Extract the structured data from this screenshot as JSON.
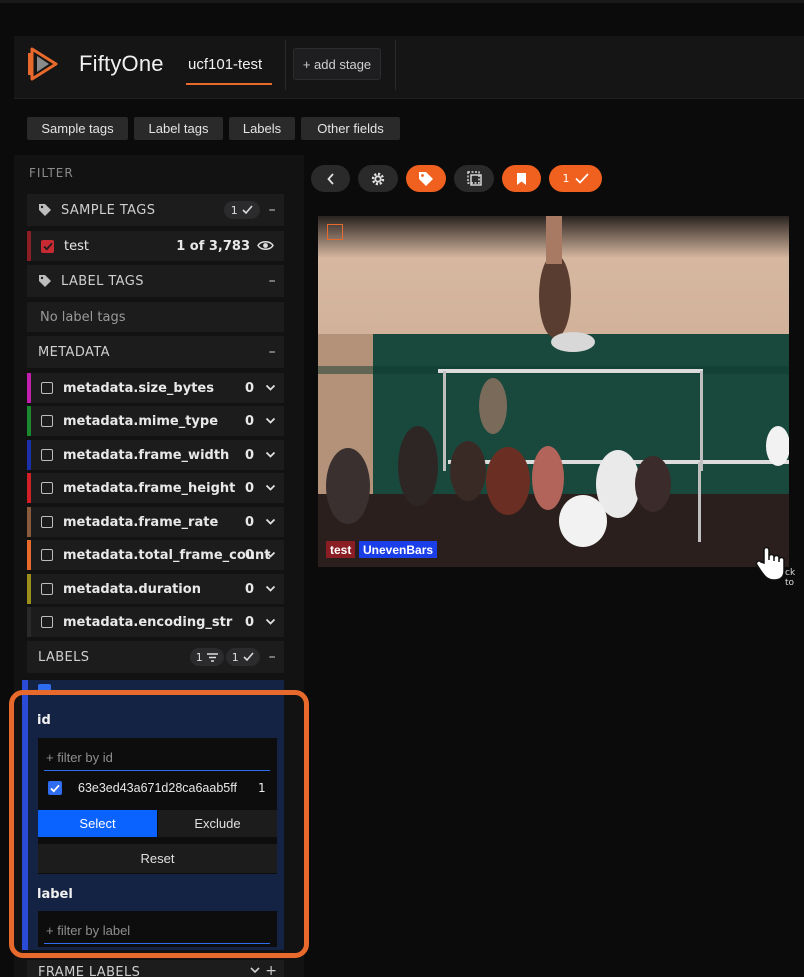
{
  "app": {
    "brand": "FiftyOne",
    "dataset": "ucf101-test",
    "add_stage": "+ add stage"
  },
  "tabs": [
    "Sample tags",
    "Label tags",
    "Labels",
    "Other fields"
  ],
  "sidebar": {
    "filter_title": "FILTER",
    "sample_tags": {
      "header": "SAMPLE TAGS",
      "selected_count": "1",
      "items": [
        {
          "label": "test",
          "count": "1 of 3,783"
        }
      ]
    },
    "label_tags": {
      "header": "LABEL TAGS",
      "empty": "No label tags"
    },
    "metadata": {
      "header": "METADATA",
      "fields": [
        {
          "label": "metadata.size_bytes",
          "count": "0",
          "color": "#c21fae"
        },
        {
          "label": "metadata.mime_type",
          "count": "0",
          "color": "#1b8a2e"
        },
        {
          "label": "metadata.frame_width",
          "count": "0",
          "color": "#1a2fa8"
        },
        {
          "label": "metadata.frame_height",
          "count": "0",
          "color": "#d01f26"
        },
        {
          "label": "metadata.frame_rate",
          "count": "0",
          "color": "#8a5a3d"
        },
        {
          "label": "metadata.total_frame_count",
          "count": "0",
          "color": "#e8692c"
        },
        {
          "label": "metadata.duration",
          "count": "0",
          "color": "#9a8f1a"
        },
        {
          "label": "metadata.encoding_str",
          "count": "0",
          "color": "#2a2a2a"
        }
      ]
    },
    "labels": {
      "header": "LABELS",
      "filter_count": "1",
      "selected_count": "1"
    },
    "ground_truth": {
      "id_title": "id",
      "id_placeholder": "+ filter by id",
      "id_value": "63e3ed43a671d28ca6aab5ff",
      "id_value_count": "1",
      "select_label": "Select",
      "exclude_label": "Exclude",
      "reset_label": "Reset",
      "label_title": "label",
      "label_placeholder": "+ filter by label"
    },
    "frame_labels": {
      "header": "FRAME LABELS"
    }
  },
  "toolbar": {
    "selected_count": "1"
  },
  "sample": {
    "tags": [
      "test",
      "UnevenBars"
    ],
    "tooltip": "ck to"
  },
  "colors": {
    "accent": "#e8692c",
    "select_blue": "#0b63ff",
    "tag_test": "#8a1e24",
    "tag_label": "#1a3fe8"
  }
}
